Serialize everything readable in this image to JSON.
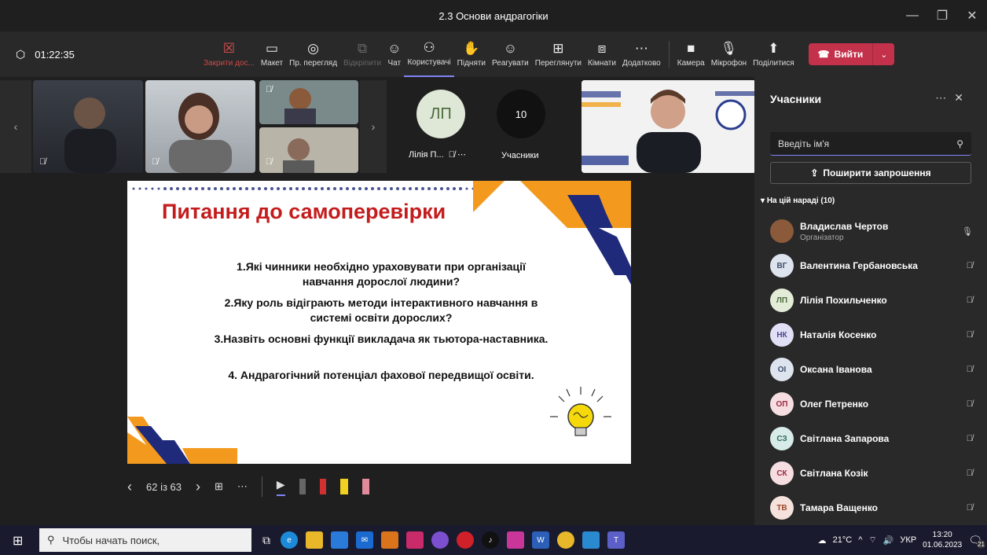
{
  "window": {
    "title": "2.3 Основи андрагогіки"
  },
  "toolbar": {
    "timer": "01:22:35",
    "buttons": [
      {
        "label": "Закрити дос...",
        "icon": "☒",
        "state": "red"
      },
      {
        "label": "Макет",
        "icon": "▭",
        "state": "normal"
      },
      {
        "label": "Пр. перегляд",
        "icon": "◎",
        "state": "normal"
      },
      {
        "label": "Відкріпити",
        "icon": "⧉",
        "state": "disabled"
      },
      {
        "label": "Чат",
        "icon": "☺",
        "state": "normal"
      },
      {
        "label": "Користувачі",
        "icon": "⚇",
        "state": "active"
      },
      {
        "label": "Підняти",
        "icon": "✋",
        "state": "normal"
      },
      {
        "label": "Реагувати",
        "icon": "☺",
        "state": "normal"
      },
      {
        "label": "Переглянути",
        "icon": "⊞",
        "state": "normal"
      },
      {
        "label": "Кімнати",
        "icon": "⧈",
        "state": "normal"
      },
      {
        "label": "Додатково",
        "icon": "⋯",
        "state": "normal"
      }
    ],
    "media": [
      {
        "label": "Камера",
        "icon": "■"
      },
      {
        "label": "Мікрофон",
        "icon": "🎙"
      },
      {
        "label": "Поділитися",
        "icon": "⬆"
      }
    ],
    "leave_label": "Вийти"
  },
  "gallery": {
    "lp_initials": "ЛП",
    "lp_name": "Лілія П...",
    "count": "10",
    "count_label": "Учасники"
  },
  "slide": {
    "title": "Питання до самоперевірки",
    "questions": [
      "1.Які чинники необхідно ураховувати при організації навчання дорослої людини?",
      "2.Яку роль відіграють методи інтерактивного навчання в системі освіти дорослих?",
      "3.Назвіть основні функції викладача як тьютора-наставника.",
      "4. Андрагогічний потенціал фахової передвищої освіти."
    ],
    "counter": "62 із 63"
  },
  "panel": {
    "title": "Учасники",
    "search_placeholder": "Введіть ім'я",
    "share_label": "Поширити запрошення",
    "section_label": "На цій нараді (10)",
    "participants": [
      {
        "initials": "",
        "name": "Владислав Чертов",
        "role": "Організатор",
        "color": "#8a5a3a",
        "text": "#fff",
        "mic": "on"
      },
      {
        "initials": "ВГ",
        "name": "Валентина Гербановська",
        "role": "",
        "color": "#dde4ee",
        "text": "#3b4d6b",
        "mic": "off"
      },
      {
        "initials": "ЛП",
        "name": "Лілія Похильченко",
        "role": "",
        "color": "#e3ecd7",
        "text": "#4c6b3b",
        "mic": "off"
      },
      {
        "initials": "НК",
        "name": "Наталія Косенко",
        "role": "",
        "color": "#e1dff5",
        "text": "#4b4693",
        "mic": "off"
      },
      {
        "initials": "ОІ",
        "name": "Оксана Іванова",
        "role": "",
        "color": "#dde4ee",
        "text": "#3b4d6b",
        "mic": "off"
      },
      {
        "initials": "ОП",
        "name": "Олег Петренко",
        "role": "",
        "color": "#f6dde2",
        "text": "#9c2a3f",
        "mic": "off"
      },
      {
        "initials": "СЗ",
        "name": "Світлана Запарова",
        "role": "",
        "color": "#d7ebe8",
        "text": "#2f6b61",
        "mic": "off"
      },
      {
        "initials": "СК",
        "name": "Світлана Козік",
        "role": "",
        "color": "#f6dde2",
        "text": "#9c2a3f",
        "mic": "off"
      },
      {
        "initials": "ТВ",
        "name": "Тамара Ващенко",
        "role": "",
        "color": "#f6e2dc",
        "text": "#9c4a2a",
        "mic": "off"
      }
    ]
  },
  "taskbar": {
    "search_placeholder": "Чтобы начать поиск,",
    "temperature": "21°C",
    "lang": "УКР",
    "time": "13:20",
    "date": "01.06.2023",
    "notifications": "21"
  }
}
